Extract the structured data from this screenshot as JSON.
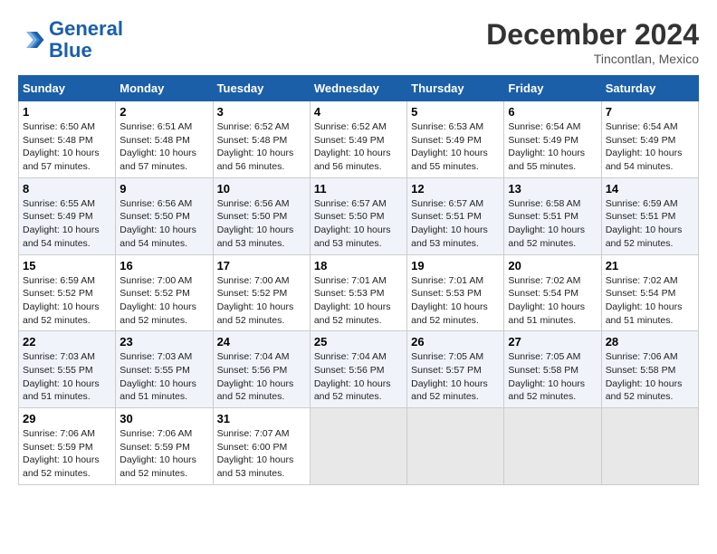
{
  "header": {
    "logo_general": "General",
    "logo_blue": "Blue",
    "month_title": "December 2024",
    "location": "Tincontlan, Mexico"
  },
  "weekdays": [
    "Sunday",
    "Monday",
    "Tuesday",
    "Wednesday",
    "Thursday",
    "Friday",
    "Saturday"
  ],
  "weeks": [
    [
      {
        "day": "1",
        "info": "Sunrise: 6:50 AM\nSunset: 5:48 PM\nDaylight: 10 hours\nand 57 minutes."
      },
      {
        "day": "2",
        "info": "Sunrise: 6:51 AM\nSunset: 5:48 PM\nDaylight: 10 hours\nand 57 minutes."
      },
      {
        "day": "3",
        "info": "Sunrise: 6:52 AM\nSunset: 5:48 PM\nDaylight: 10 hours\nand 56 minutes."
      },
      {
        "day": "4",
        "info": "Sunrise: 6:52 AM\nSunset: 5:49 PM\nDaylight: 10 hours\nand 56 minutes."
      },
      {
        "day": "5",
        "info": "Sunrise: 6:53 AM\nSunset: 5:49 PM\nDaylight: 10 hours\nand 55 minutes."
      },
      {
        "day": "6",
        "info": "Sunrise: 6:54 AM\nSunset: 5:49 PM\nDaylight: 10 hours\nand 55 minutes."
      },
      {
        "day": "7",
        "info": "Sunrise: 6:54 AM\nSunset: 5:49 PM\nDaylight: 10 hours\nand 54 minutes."
      }
    ],
    [
      {
        "day": "8",
        "info": "Sunrise: 6:55 AM\nSunset: 5:49 PM\nDaylight: 10 hours\nand 54 minutes."
      },
      {
        "day": "9",
        "info": "Sunrise: 6:56 AM\nSunset: 5:50 PM\nDaylight: 10 hours\nand 54 minutes."
      },
      {
        "day": "10",
        "info": "Sunrise: 6:56 AM\nSunset: 5:50 PM\nDaylight: 10 hours\nand 53 minutes."
      },
      {
        "day": "11",
        "info": "Sunrise: 6:57 AM\nSunset: 5:50 PM\nDaylight: 10 hours\nand 53 minutes."
      },
      {
        "day": "12",
        "info": "Sunrise: 6:57 AM\nSunset: 5:51 PM\nDaylight: 10 hours\nand 53 minutes."
      },
      {
        "day": "13",
        "info": "Sunrise: 6:58 AM\nSunset: 5:51 PM\nDaylight: 10 hours\nand 52 minutes."
      },
      {
        "day": "14",
        "info": "Sunrise: 6:59 AM\nSunset: 5:51 PM\nDaylight: 10 hours\nand 52 minutes."
      }
    ],
    [
      {
        "day": "15",
        "info": "Sunrise: 6:59 AM\nSunset: 5:52 PM\nDaylight: 10 hours\nand 52 minutes."
      },
      {
        "day": "16",
        "info": "Sunrise: 7:00 AM\nSunset: 5:52 PM\nDaylight: 10 hours\nand 52 minutes."
      },
      {
        "day": "17",
        "info": "Sunrise: 7:00 AM\nSunset: 5:52 PM\nDaylight: 10 hours\nand 52 minutes."
      },
      {
        "day": "18",
        "info": "Sunrise: 7:01 AM\nSunset: 5:53 PM\nDaylight: 10 hours\nand 52 minutes."
      },
      {
        "day": "19",
        "info": "Sunrise: 7:01 AM\nSunset: 5:53 PM\nDaylight: 10 hours\nand 52 minutes."
      },
      {
        "day": "20",
        "info": "Sunrise: 7:02 AM\nSunset: 5:54 PM\nDaylight: 10 hours\nand 51 minutes."
      },
      {
        "day": "21",
        "info": "Sunrise: 7:02 AM\nSunset: 5:54 PM\nDaylight: 10 hours\nand 51 minutes."
      }
    ],
    [
      {
        "day": "22",
        "info": "Sunrise: 7:03 AM\nSunset: 5:55 PM\nDaylight: 10 hours\nand 51 minutes."
      },
      {
        "day": "23",
        "info": "Sunrise: 7:03 AM\nSunset: 5:55 PM\nDaylight: 10 hours\nand 51 minutes."
      },
      {
        "day": "24",
        "info": "Sunrise: 7:04 AM\nSunset: 5:56 PM\nDaylight: 10 hours\nand 52 minutes."
      },
      {
        "day": "25",
        "info": "Sunrise: 7:04 AM\nSunset: 5:56 PM\nDaylight: 10 hours\nand 52 minutes."
      },
      {
        "day": "26",
        "info": "Sunrise: 7:05 AM\nSunset: 5:57 PM\nDaylight: 10 hours\nand 52 minutes."
      },
      {
        "day": "27",
        "info": "Sunrise: 7:05 AM\nSunset: 5:58 PM\nDaylight: 10 hours\nand 52 minutes."
      },
      {
        "day": "28",
        "info": "Sunrise: 7:06 AM\nSunset: 5:58 PM\nDaylight: 10 hours\nand 52 minutes."
      }
    ],
    [
      {
        "day": "29",
        "info": "Sunrise: 7:06 AM\nSunset: 5:59 PM\nDaylight: 10 hours\nand 52 minutes."
      },
      {
        "day": "30",
        "info": "Sunrise: 7:06 AM\nSunset: 5:59 PM\nDaylight: 10 hours\nand 52 minutes."
      },
      {
        "day": "31",
        "info": "Sunrise: 7:07 AM\nSunset: 6:00 PM\nDaylight: 10 hours\nand 53 minutes."
      },
      {
        "day": "",
        "info": ""
      },
      {
        "day": "",
        "info": ""
      },
      {
        "day": "",
        "info": ""
      },
      {
        "day": "",
        "info": ""
      }
    ]
  ]
}
